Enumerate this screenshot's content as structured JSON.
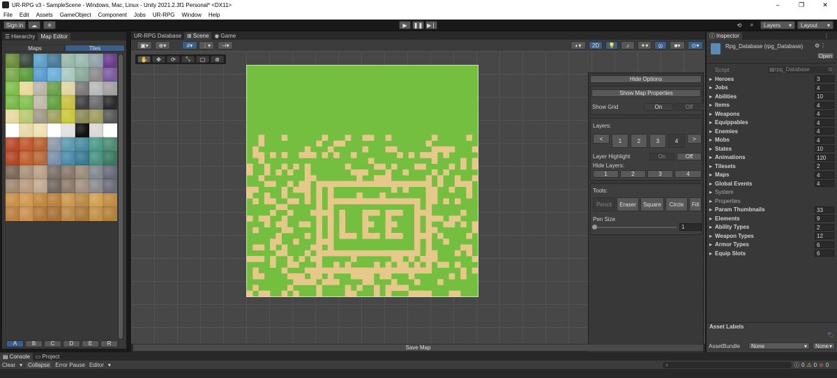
{
  "window": {
    "title": "UR-RPG v3 - SampleScene - Windows, Mac, Linux - Unity 2021.2.3f1 Personal* <DX11>",
    "controls": [
      "–",
      "❐",
      "✕"
    ]
  },
  "menu": [
    "File",
    "Edit",
    "Assets",
    "GameObject",
    "Component",
    "Jobs",
    "UR-RPG",
    "Window",
    "Help"
  ],
  "toolbar": {
    "sign_in": "Sign in",
    "play": "▶",
    "pause": "❚❚",
    "step": "▶❘",
    "layers": "Layers",
    "layout": "Layout",
    "history": "⟲",
    "search": "⌕"
  },
  "left_panel": {
    "tabs": [
      "Hierarchy",
      "Map Editor"
    ],
    "subtabs": [
      "Maps",
      "Tiles"
    ],
    "tile_pages": [
      "A",
      "B",
      "C",
      "D",
      "E",
      "R"
    ],
    "tile_colors": [
      [
        "#6a8c3a",
        "#3c4a3c",
        "#5ea0c8",
        "#487a9a",
        "#98b8a8",
        "#9ab8b0",
        "#90a0a8",
        "#6a3c8a"
      ],
      [
        "#7aa84c",
        "#5a9a3a",
        "#5a9ad0",
        "#6ab0d8",
        "#a8c8c0",
        "#88a898",
        "#8a8a8a",
        "#7a5aa0"
      ],
      [
        "#7cc04a",
        "#e8d89a",
        "#b8b4a8",
        "#6aa048",
        "#e0d4a0",
        "#787878",
        "#b8b8b8",
        "#a0a0a0"
      ],
      [
        "#78b848",
        "#80c050",
        "#c0b8a8",
        "#60a040",
        "#c8c040",
        "#404040",
        "#6a6a6a",
        "#2a2a2a"
      ],
      [
        "#e8d8a0",
        "#b8c870",
        "#a09888",
        "#a0a060",
        "#c8c838",
        "#8a8a5a",
        "#a09a60",
        "#585858"
      ],
      [
        "#ffffff",
        "#e8d8a8",
        "#f0e0b0",
        "#ffffff",
        "#e0e0e0",
        "#101010",
        "#d8d8d8",
        "#ffffff"
      ],
      [
        "#b84a2a",
        "#c05830",
        "#b86030",
        "#8a98a8",
        "#5a98b0",
        "#4a8aa0",
        "#4a9a8a",
        "#4a8a70"
      ],
      [
        "#b04828",
        "#c06030",
        "#b86838",
        "#7890a8",
        "#4a8aa8",
        "#3a7890",
        "#4a9080",
        "#3a7860"
      ],
      [
        "#7a6858",
        "#a89078",
        "#b8a088",
        "#7a7068",
        "#88786a",
        "#9a8a78",
        "#808890",
        "#686878"
      ],
      [
        "#a08870",
        "#b89880",
        "#c0a890",
        "#706860",
        "#8a7a6a",
        "#a09080",
        "#8a8a8a",
        "#6a6a78"
      ],
      [
        "#c89048",
        "#d09850",
        "#c08840",
        "#b88040",
        "#c89850",
        "#b88848",
        "#d0a050",
        "#c08a40"
      ],
      [
        "#b88040",
        "#c89050",
        "#b07838",
        "#a87038",
        "#b88848",
        "#a87838",
        "#c09048",
        "#b08038"
      ]
    ]
  },
  "scene": {
    "tabs": [
      "UR-RPG Database",
      "Scene",
      "Game"
    ],
    "btn_2d": "2D",
    "save_map": "Save Map",
    "map_text": "LEE"
  },
  "options": {
    "hide_options": "Hide Options",
    "show_map_properties": "Show Map Properties",
    "show_grid": "Show Grid",
    "on": "On",
    "off": "Off",
    "layers_label": "Layers:",
    "prev": "<",
    "next": ">",
    "layers": [
      "1",
      "2",
      "3",
      "4"
    ],
    "layer_highlight": "Layer Highlight",
    "hide_layers": "Hide Layers:",
    "tools_label": "Tools:",
    "tools": [
      "Pencil",
      "Eraser",
      "Square",
      "Circle",
      "Fill"
    ],
    "pen_size_label": "Pen Size",
    "pen_size": "1"
  },
  "inspector": {
    "tab": "Inspector",
    "object_name": "Rpg_Database (rpg_Database)",
    "open": "Open",
    "script_label": "Script",
    "script_value": "rpg_Database",
    "fields": [
      {
        "label": "Heroes",
        "value": "3"
      },
      {
        "label": "Jobs",
        "value": "4"
      },
      {
        "label": "Abilities",
        "value": "10"
      },
      {
        "label": "Items",
        "value": "4"
      },
      {
        "label": "Weapons",
        "value": "4"
      },
      {
        "label": "Equippables",
        "value": "4"
      },
      {
        "label": "Enemies",
        "value": "4"
      },
      {
        "label": "Mobs",
        "value": "4"
      },
      {
        "label": "States",
        "value": "10"
      },
      {
        "label": "Animations",
        "value": "120"
      },
      {
        "label": "Tilesets",
        "value": "2"
      },
      {
        "label": "Maps",
        "value": "4"
      },
      {
        "label": "Global Events",
        "value": "4"
      },
      {
        "label": "System",
        "value": ""
      },
      {
        "label": "Properties",
        "value": ""
      },
      {
        "label": "Param Thumbnails",
        "value": "33"
      },
      {
        "label": "Elements",
        "value": "9"
      },
      {
        "label": "Ability Types",
        "value": "2"
      },
      {
        "label": "Weapon Types",
        "value": "12"
      },
      {
        "label": "Armor Types",
        "value": "6"
      },
      {
        "label": "Equip Slots",
        "value": "6"
      }
    ],
    "asset_labels": "Asset Labels",
    "asset_bundle": "AssetBundle",
    "none": "None"
  },
  "console": {
    "tabs": [
      "Console",
      "Project"
    ],
    "clear": "Clear",
    "collapse": "Collapse",
    "error_pause": "Error Pause",
    "editor": "Editor",
    "count_info": "0",
    "count_warn": "0",
    "count_err": "0"
  },
  "colors": {
    "grass": "#74bf40",
    "sand": "#e6c98a"
  }
}
